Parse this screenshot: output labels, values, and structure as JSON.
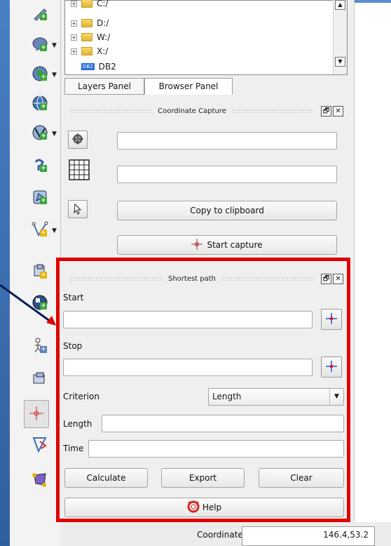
{
  "browser_tree": {
    "items": [
      {
        "label": "C:/",
        "type": "folder"
      },
      {
        "label": "D:/",
        "type": "folder"
      },
      {
        "label": "W:/",
        "type": "folder"
      },
      {
        "label": "X:/",
        "type": "folder"
      },
      {
        "label": "DB2",
        "type": "db2",
        "badge": "DB2"
      }
    ]
  },
  "tabs": [
    {
      "label": "Layers Panel",
      "active": false
    },
    {
      "label": "Browser Panel",
      "active": true
    }
  ],
  "coordinate_capture": {
    "title": "Coordinate Capture",
    "field1_value": "",
    "field2_value": "",
    "copy_label": "Copy to clipboard",
    "start_label": "Start capture"
  },
  "shortest_path": {
    "title": "Shortest path",
    "start_label": "Start",
    "start_value": "",
    "stop_label": "Stop",
    "stop_value": "",
    "criterion_label": "Criterion",
    "criterion_value": "Length",
    "length_label": "Length",
    "length_value": "",
    "time_label": "Time",
    "time_value": "",
    "calculate_label": "Calculate",
    "export_label": "Export",
    "clear_label": "Clear",
    "help_label": "Help"
  },
  "status_bar": {
    "coordinate_label": "Coordinate",
    "coordinate_value": "146.4,53.2"
  },
  "colors": {
    "highlight_frame": "#e00000",
    "window_accent": "#5b8fd0"
  },
  "title_buttons": {
    "float": "🗗",
    "close": "✕"
  },
  "tree_scroll": {
    "up": "▲",
    "down": "▼"
  }
}
